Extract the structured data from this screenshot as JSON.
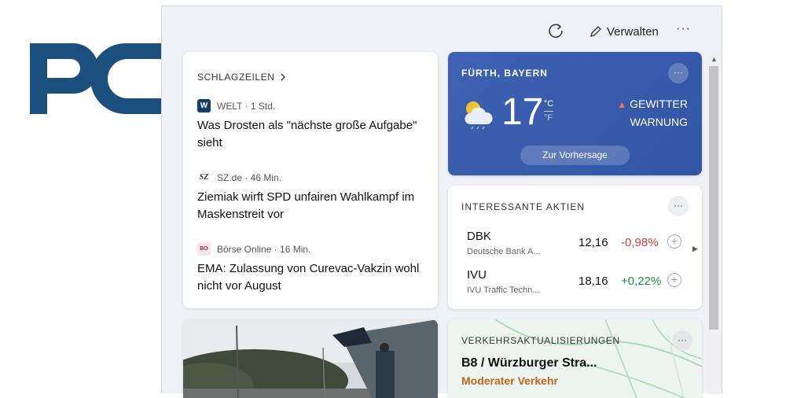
{
  "colors": {
    "brand_logo": "#1b4f7e",
    "weather_bg": "#3a5aab",
    "stock_negative": "#d13b3b",
    "stock_positive": "#1e8a3e",
    "traffic_moderate": "#c6651a"
  },
  "background_logo": {
    "text": "PC"
  },
  "toolbar": {
    "refresh_icon": "refresh-icon",
    "manage_label": "Verwalten",
    "more_label": "···"
  },
  "headlines": {
    "title": "SCHLAGZEILEN",
    "items": [
      {
        "source_logo": "W",
        "source": "WELT · 1 Std.",
        "headline": "Was Drosten als \"nächste große Aufgabe\" sieht"
      },
      {
        "source_logo": "SZ",
        "source": "SZ.de · 46 Min.",
        "headline": "Ziemiak wirft SPD unfairen Wahlkampf im Maskenstreit vor"
      },
      {
        "source_logo": "BO",
        "source": "Börse Online · 16 Min.",
        "headline": "EMA: Zulassung von Curevac-Vakzin wohl nicht vor August"
      }
    ]
  },
  "weather": {
    "location": "FÜRTH, BAYERN",
    "more_label": "···",
    "icon": "partly-cloudy-icon",
    "temperature": "17",
    "unit_c": "°C",
    "unit_f": "°F",
    "alert_line1": "GEWITTER",
    "alert_line2": "WARNUNG",
    "forecast_label": "Zur Vorhersage"
  },
  "stocks": {
    "title": "INTERESSANTE AKTIEN",
    "more_label": "···",
    "items": [
      {
        "symbol": "DBK",
        "name": "Deutsche Bank A...",
        "price": "12,16",
        "change": "-0,98%",
        "direction": "down"
      },
      {
        "symbol": "IVU",
        "name": "IVU Traffic Techn...",
        "price": "18,16",
        "change": "+0,22%",
        "direction": "up"
      }
    ],
    "add_label": "+"
  },
  "traffic": {
    "title": "VERKEHRSAKTUALISIERUNGEN",
    "more_label": "···",
    "road": "B8 / Würzburger Stra...",
    "status": "Moderater Verkehr"
  }
}
